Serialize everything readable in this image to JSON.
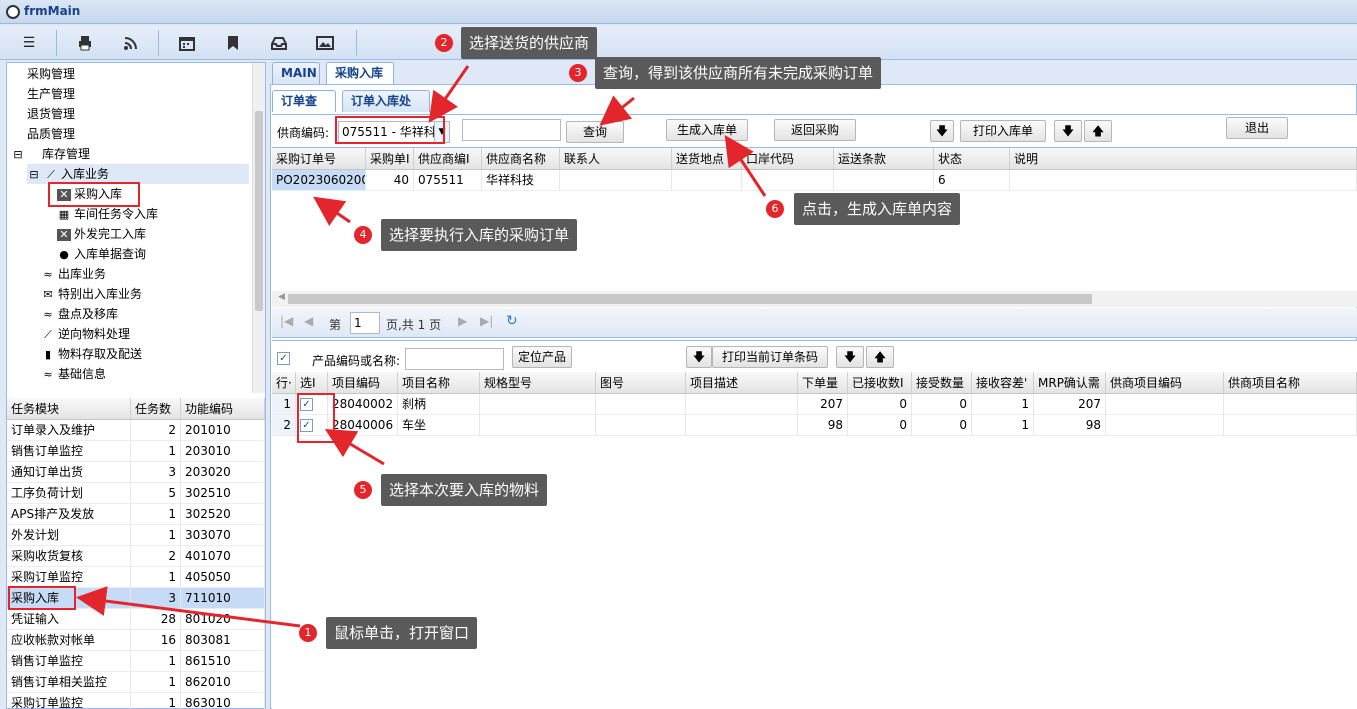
{
  "window": {
    "title": "frmMain"
  },
  "tree": [
    {
      "label": "采购管理",
      "icon": "none",
      "indent": 0
    },
    {
      "label": "生产管理",
      "icon": "none",
      "indent": 0
    },
    {
      "label": "退货管理",
      "icon": "none",
      "indent": 0
    },
    {
      "label": "品质管理",
      "icon": "none",
      "indent": 0
    },
    {
      "label": "库存管理",
      "icon": "collapse",
      "indent": 1
    },
    {
      "label": "入库业务",
      "icon": "chart",
      "indent": 2
    },
    {
      "label": "采购入库",
      "icon": "x",
      "indent": 3
    },
    {
      "label": "车间任务令入库",
      "icon": "calendar",
      "indent": 3
    },
    {
      "label": "外发完工入库",
      "icon": "x",
      "indent": 3
    },
    {
      "label": "入库单据查询",
      "icon": "user",
      "indent": 3
    },
    {
      "label": "出库业务",
      "icon": "rss",
      "indent": 2
    },
    {
      "label": "特别出入库业务",
      "icon": "mail",
      "indent": 2
    },
    {
      "label": "盘点及移库",
      "icon": "rss",
      "indent": 2
    },
    {
      "label": "逆向物料处理",
      "icon": "chart",
      "indent": 2
    },
    {
      "label": "物料存取及配送",
      "icon": "bookmark",
      "indent": 2
    },
    {
      "label": "基础信息",
      "icon": "rss",
      "indent": 2
    }
  ],
  "task_grid": {
    "headers": [
      "任务模块",
      "任务数",
      "功能编码"
    ],
    "rows": [
      [
        "订单录入及维护",
        "2",
        "201010"
      ],
      [
        "销售订单监控",
        "1",
        "203010"
      ],
      [
        "通知订单出货",
        "3",
        "203020"
      ],
      [
        "工序负荷计划",
        "5",
        "302510"
      ],
      [
        "APS排产及发放",
        "1",
        "302520"
      ],
      [
        "外发计划",
        "1",
        "303070"
      ],
      [
        "采购收货复核",
        "2",
        "401070"
      ],
      [
        "采购订单监控",
        "1",
        "405050"
      ],
      [
        "采购入库",
        "3",
        "711010"
      ],
      [
        "凭证输入",
        "28",
        "801020"
      ],
      [
        "应收帐款对帐单",
        "16",
        "803081"
      ],
      [
        "销售订单监控",
        "1",
        "861510"
      ],
      [
        "销售订单相关监控",
        "1",
        "862010"
      ],
      [
        "采购订单监控",
        "1",
        "863010"
      ]
    ]
  },
  "tabs": {
    "main": "MAIN",
    "purchase_in": "采购入库",
    "order_query": "订单查询",
    "order_process": "订单入库处理"
  },
  "query": {
    "supplier_label": "供商编码:",
    "supplier_value": "075511 - 华祥科",
    "query_btn": "查询",
    "generate_btn": "生成入库单",
    "return_btn": "返回采购",
    "print_btn": "打印入库单",
    "exit_btn": "退出"
  },
  "order_grid": {
    "headers": [
      "采购订单号",
      "采购单I",
      "供应商编I",
      "供应商名称",
      "联系人",
      "送货地点",
      "口岸代码",
      "运送条款",
      "状态",
      "说明"
    ],
    "rows": [
      [
        "PO2023060200",
        "40",
        "075511",
        "华祥科技",
        "",
        "",
        "",
        "",
        "6",
        ""
      ]
    ]
  },
  "pager": {
    "page_label": "第",
    "page_value": "1",
    "page_of": "页,共 1 页"
  },
  "product": {
    "label": "产品编码或名称:",
    "locate_btn": "定位产品",
    "print_barcode_btn": "打印当前订单条码"
  },
  "item_grid": {
    "headers": [
      "行·",
      "选I",
      "项目编码",
      "项目名称",
      "规格型号",
      "图号",
      "项目描述",
      "下单量",
      "已接收数I",
      "接受数量",
      "接收容差'",
      "MRP确认需",
      "供商项目编码",
      "供商项目名称"
    ],
    "rows": [
      [
        "1",
        "✓",
        "28040002",
        "刹柄",
        "",
        "",
        "",
        "207",
        "0",
        "0",
        "1",
        "207",
        "",
        ""
      ],
      [
        "2",
        "✓",
        "28040006",
        "车坐",
        "",
        "",
        "",
        "98",
        "0",
        "0",
        "1",
        "98",
        "",
        ""
      ]
    ]
  },
  "callouts": [
    {
      "n": "1",
      "text": "鼠标单击，打开窗口"
    },
    {
      "n": "2",
      "text": "选择送货的供应商"
    },
    {
      "n": "3",
      "text": "查询，得到该供应商所有未完成采购订单"
    },
    {
      "n": "4",
      "text": "选择要执行入库的采购订单"
    },
    {
      "n": "5",
      "text": "选择本次要入库的物料"
    },
    {
      "n": "6",
      "text": "点击，生成入库单内容"
    }
  ],
  "colors": {
    "accent": "#15428b",
    "annotation_red": "#e2262b",
    "callout_bg": "#5a5a5a",
    "panel_border": "#99bbe8"
  },
  "toolbar_icons": [
    "menu-icon",
    "print-icon",
    "rss-icon",
    "calendar-icon",
    "bookmark-icon",
    "inbox-icon",
    "image-icon"
  ]
}
